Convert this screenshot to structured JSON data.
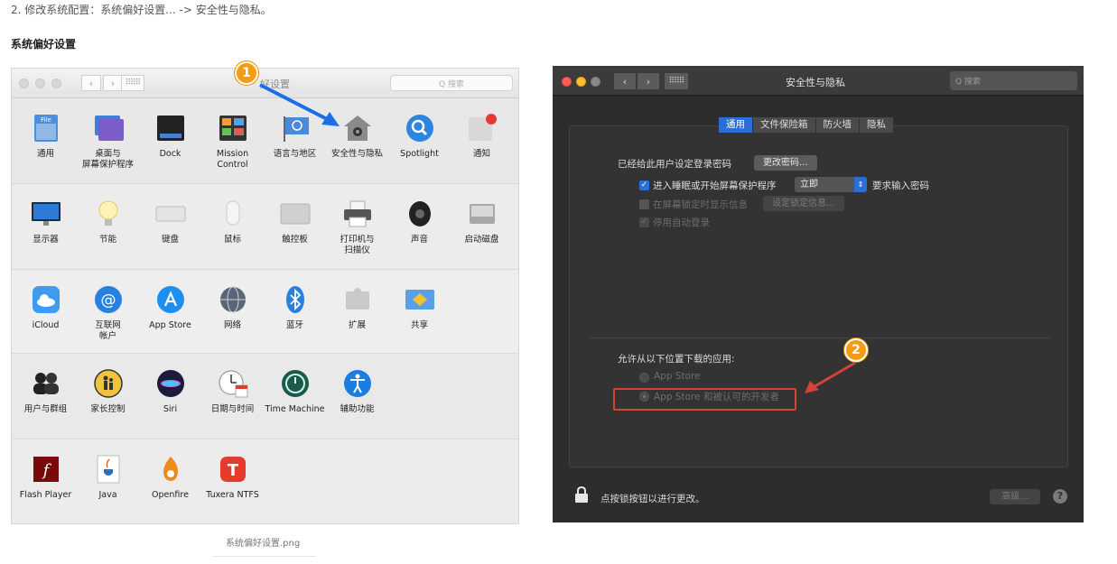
{
  "doc": {
    "step_text": "2. 修改系统配置：系统偏好设置... -> 安全性与隐私。",
    "section_title": "系统偏好设置",
    "caption": "系统偏好设置.png"
  },
  "syspref": {
    "title": "好设置",
    "search_placeholder": "Q 搜索",
    "back": "‹",
    "forward": "›",
    "grid": "⠿⠿⠿",
    "marker": "1",
    "rows": [
      [
        {
          "label": "通用",
          "icon": "general-icon"
        },
        {
          "label": "桌面与\n屏幕保护程序",
          "icon": "desktop-icon"
        },
        {
          "label": "Dock",
          "icon": "dock-icon"
        },
        {
          "label": "Mission\nControl",
          "icon": "mission-control-icon"
        },
        {
          "label": "语言与地区",
          "icon": "language-flag-icon"
        },
        {
          "label": "安全性与隐私",
          "icon": "security-house-icon"
        },
        {
          "label": "Spotlight",
          "icon": "spotlight-icon"
        },
        {
          "label": "通知",
          "icon": "notifications-icon"
        }
      ],
      [
        {
          "label": "显示器",
          "icon": "display-icon"
        },
        {
          "label": "节能",
          "icon": "energy-bulb-icon"
        },
        {
          "label": "键盘",
          "icon": "keyboard-icon"
        },
        {
          "label": "鼠标",
          "icon": "mouse-icon"
        },
        {
          "label": "触控板",
          "icon": "trackpad-icon"
        },
        {
          "label": "打印机与\n扫描仪",
          "icon": "printer-icon"
        },
        {
          "label": "声音",
          "icon": "speaker-icon"
        },
        {
          "label": "启动磁盘",
          "icon": "disk-icon"
        }
      ],
      [
        {
          "label": "iCloud",
          "icon": "icloud-icon"
        },
        {
          "label": "互联网\n帐户",
          "icon": "internet-accounts-icon"
        },
        {
          "label": "App Store",
          "icon": "app-store-icon"
        },
        {
          "label": "网络",
          "icon": "network-globe-icon"
        },
        {
          "label": "蓝牙",
          "icon": "bluetooth-icon"
        },
        {
          "label": "扩展",
          "icon": "extensions-puzzle-icon"
        },
        {
          "label": "共享",
          "icon": "sharing-icon"
        }
      ],
      [
        {
          "label": "用户与群组",
          "icon": "users-icon"
        },
        {
          "label": "家长控制",
          "icon": "parental-controls-icon"
        },
        {
          "label": "Siri",
          "icon": "siri-icon"
        },
        {
          "label": "日期与时间",
          "icon": "clock-calendar-icon"
        },
        {
          "label": "Time Machine",
          "icon": "time-machine-icon"
        },
        {
          "label": "辅助功能",
          "icon": "accessibility-icon"
        }
      ],
      [
        {
          "label": "Flash Player",
          "icon": "flash-icon"
        },
        {
          "label": "Java",
          "icon": "java-icon"
        },
        {
          "label": "Openfire",
          "icon": "openfire-icon"
        },
        {
          "label": "Tuxera NTFS",
          "icon": "tuxera-icon"
        }
      ]
    ]
  },
  "security": {
    "title": "安全性与隐私",
    "search_placeholder": "Q 搜索",
    "back": "‹",
    "forward": "›",
    "grid": "⠿⠿⠿",
    "tabs": [
      "通用",
      "文件保险箱",
      "防火墙",
      "隐私"
    ],
    "password_set_text": "已经给此用户设定登录密码",
    "change_password_button": "更改密码...",
    "sleep_checkbox_label": "进入睡眠或开始屏幕保护程序",
    "sleep_select_value": "立即",
    "require_password_text": "要求输入密码",
    "lock_message_label": "在屏幕锁定时显示信息",
    "set_lock_message_button": "设定锁定信息...",
    "disable_autologin_label": "停用自动登录",
    "allow_apps_title": "允许从以下位置下载的应用:",
    "radio_app_store": "App Store",
    "radio_app_store_devs": "App Store 和被认可的开发者",
    "lock_text": "点按锁按钮以进行更改。",
    "advanced_button": "高级...",
    "help_button": "?",
    "marker": "2",
    "colors": {
      "highlight": "#d9403a",
      "accent": "#2b6fd6",
      "marker": "#f39c12"
    }
  }
}
